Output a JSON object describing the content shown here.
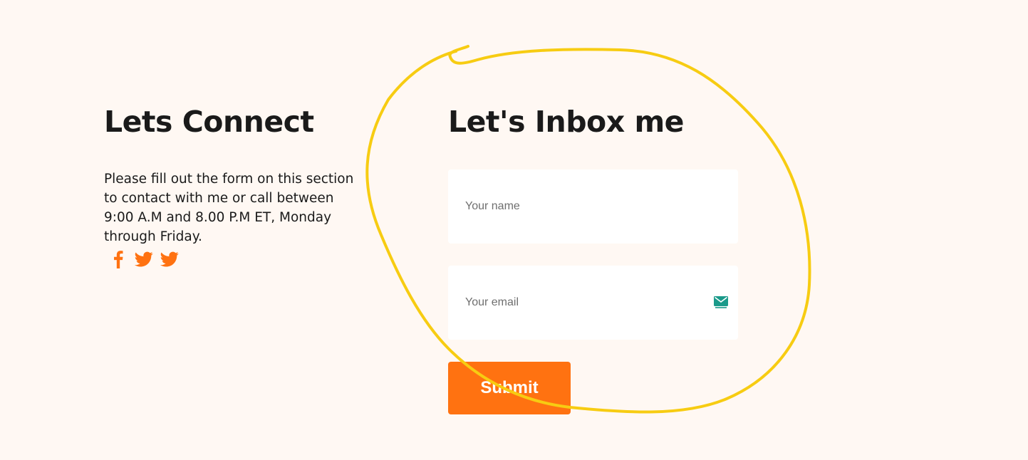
{
  "contact_info": {
    "title": "Lets Connect",
    "description": "Please fill out the form on this section to contact with me or call between 9:00 A.M and 8.00 P.M ET, Monday through Friday.",
    "social_icons": [
      "facebook-icon",
      "twitter-icon",
      "twitter-icon"
    ]
  },
  "contact_form": {
    "title": "Let's Inbox me",
    "name_placeholder": "Your name",
    "name_value": "",
    "email_placeholder": "Your email",
    "email_value": "",
    "submit_label": "Submit"
  },
  "colors": {
    "background": "#fff8f3",
    "accent": "#ff7211",
    "field_background": "#ffffff",
    "annotation_stroke": "#f7cc12"
  }
}
